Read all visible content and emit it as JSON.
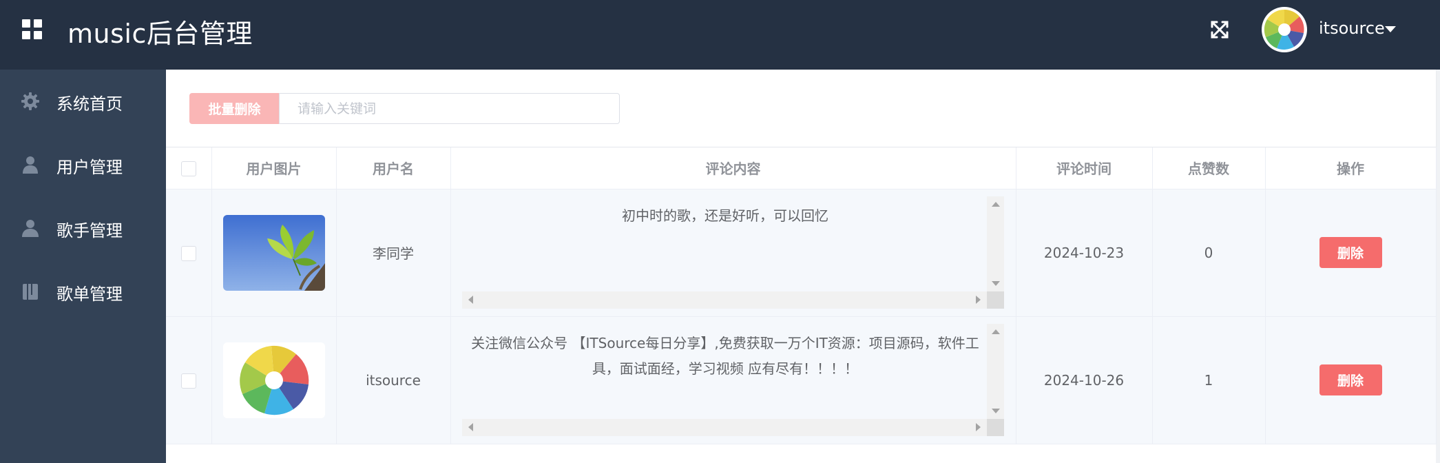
{
  "header": {
    "title": "music后台管理",
    "username": "itsource",
    "menu_icon": "grid-icon",
    "fullscreen_icon": "fullscreen-icon",
    "background": "#253143"
  },
  "sidebar": {
    "background": "#334256",
    "items": [
      {
        "label": "系统首页",
        "icon": "gear-icon"
      },
      {
        "label": "用户管理",
        "icon": "user-icon"
      },
      {
        "label": "歌手管理",
        "icon": "singer-icon"
      },
      {
        "label": "歌单管理",
        "icon": "playlist-icon"
      }
    ]
  },
  "toolbar": {
    "batch_delete_label": "批量删除",
    "search_placeholder": "请输入关键词"
  },
  "table": {
    "columns": [
      "用户图片",
      "用户名",
      "评论内容",
      "评论时间",
      "点赞数",
      "操作"
    ],
    "rows": [
      {
        "image": "ginkgo-leaf-photo",
        "username": "李同学",
        "comment": "初中时的歌，还是好听，可以回忆",
        "time": "2024-10-23",
        "likes": "0",
        "action": "删除"
      },
      {
        "image": "aperture-logo",
        "username": "itsource",
        "comment": "关注微信公众号 【ITSource每日分享】,免费获取一万个IT资源：项目源码，软件工具，面试面经，学习视频 应有尽有！！！！",
        "time": "2024-10-26",
        "likes": "1",
        "action": "删除"
      }
    ]
  },
  "colors": {
    "danger": "#f56c6c",
    "danger_light": "#fab6b6"
  }
}
